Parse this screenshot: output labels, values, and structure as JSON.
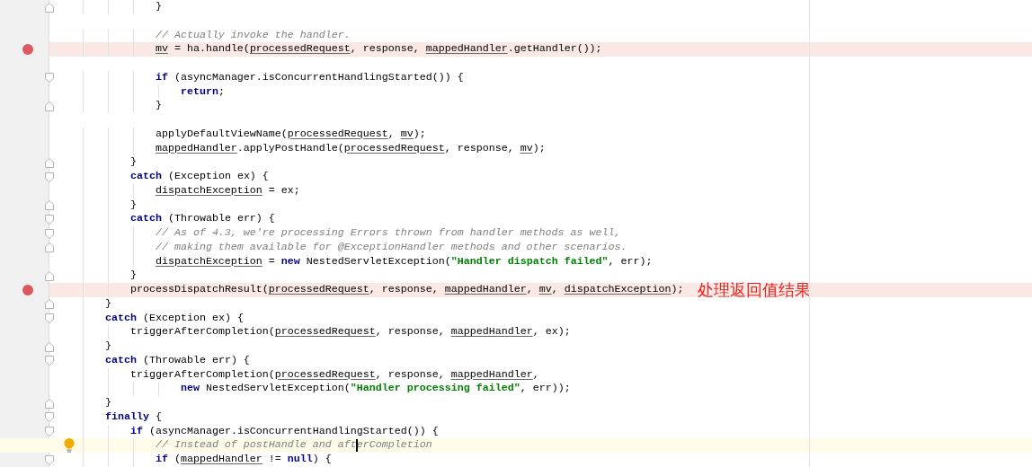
{
  "editor": {
    "lines": [
      {
        "kind": "code",
        "fold_marker": {
          "kind": "end"
        },
        "tokens": [
          {
            "kind": "plain",
            "text": "                }"
          }
        ]
      },
      {
        "kind": "blank"
      },
      {
        "kind": "code",
        "tokens": [
          {
            "kind": "comment",
            "text": "                // Actually invoke the handler."
          }
        ]
      },
      {
        "kind": "code",
        "breakpoint": true,
        "tokens": [
          {
            "kind": "var",
            "text": "                mv"
          },
          {
            "kind": "plain",
            "text": " = ha.handle("
          },
          {
            "kind": "var",
            "text": "processedRequest"
          },
          {
            "kind": "plain",
            "text": ", response, "
          },
          {
            "kind": "var",
            "text": "mappedHandler"
          },
          {
            "kind": "plain",
            "text": ".getHandler());"
          }
        ]
      },
      {
        "kind": "blank"
      },
      {
        "kind": "code",
        "fold_marker": {
          "kind": "start"
        },
        "tokens": [
          {
            "kind": "keyword",
            "text": "                if"
          },
          {
            "kind": "plain",
            "text": " (asyncManager.isConcurrentHandlingStarted()) {"
          }
        ]
      },
      {
        "kind": "code",
        "tokens": [
          {
            "kind": "keyword",
            "text": "                    return"
          },
          {
            "kind": "plain",
            "text": ";"
          }
        ]
      },
      {
        "kind": "code",
        "fold_marker": {
          "kind": "end"
        },
        "tokens": [
          {
            "kind": "plain",
            "text": "                }"
          }
        ]
      },
      {
        "kind": "blank"
      },
      {
        "kind": "code",
        "tokens": [
          {
            "kind": "plain",
            "text": "                applyDefaultViewName("
          },
          {
            "kind": "var",
            "text": "processedRequest"
          },
          {
            "kind": "plain",
            "text": ", "
          },
          {
            "kind": "var",
            "text": "mv"
          },
          {
            "kind": "plain",
            "text": ");"
          }
        ]
      },
      {
        "kind": "code",
        "tokens": [
          {
            "kind": "var",
            "text": "                mappedHandler"
          },
          {
            "kind": "plain",
            "text": ".applyPostHandle("
          },
          {
            "kind": "var",
            "text": "processedRequest"
          },
          {
            "kind": "plain",
            "text": ", response, "
          },
          {
            "kind": "var",
            "text": "mv"
          },
          {
            "kind": "plain",
            "text": ");"
          }
        ]
      },
      {
        "kind": "code",
        "fold_marker": {
          "kind": "end"
        },
        "tokens": [
          {
            "kind": "plain",
            "text": "            }"
          }
        ]
      },
      {
        "kind": "code",
        "fold_marker": {
          "kind": "start"
        },
        "tokens": [
          {
            "kind": "keyword",
            "text": "            catch"
          },
          {
            "kind": "plain",
            "text": " (Exception ex) {"
          }
        ]
      },
      {
        "kind": "code",
        "tokens": [
          {
            "kind": "var",
            "text": "                dispatchException"
          },
          {
            "kind": "plain",
            "text": " = ex;"
          }
        ]
      },
      {
        "kind": "code",
        "fold_marker": {
          "kind": "end"
        },
        "tokens": [
          {
            "kind": "plain",
            "text": "            }"
          }
        ]
      },
      {
        "kind": "code",
        "fold_marker": {
          "kind": "start"
        },
        "tokens": [
          {
            "kind": "keyword",
            "text": "            catch"
          },
          {
            "kind": "plain",
            "text": " (Throwable err) {"
          }
        ]
      },
      {
        "kind": "code",
        "fold_marker": {
          "kind": "start"
        },
        "tokens": [
          {
            "kind": "comment",
            "text": "                // As of 4.3, we're processing Errors thrown from handler methods as well,"
          }
        ]
      },
      {
        "kind": "code",
        "fold_marker": {
          "kind": "end"
        },
        "tokens": [
          {
            "kind": "comment",
            "text": "                // making them available for @ExceptionHandler methods and other scenarios."
          }
        ]
      },
      {
        "kind": "code",
        "tokens": [
          {
            "kind": "var",
            "text": "                dispatchException"
          },
          {
            "kind": "plain",
            "text": " = "
          },
          {
            "kind": "keyword",
            "text": "new"
          },
          {
            "kind": "plain",
            "text": " NestedServletException("
          },
          {
            "kind": "string",
            "text": "\"Handler dispatch failed\""
          },
          {
            "kind": "plain",
            "text": ", err);"
          }
        ]
      },
      {
        "kind": "code",
        "fold_marker": {
          "kind": "end"
        },
        "tokens": [
          {
            "kind": "plain",
            "text": "            }"
          }
        ]
      },
      {
        "kind": "code",
        "breakpoint": true,
        "annotation": "处理返回值结果",
        "tokens": [
          {
            "kind": "plain",
            "text": "            processDispatchResult("
          },
          {
            "kind": "var",
            "text": "processedRequest"
          },
          {
            "kind": "plain",
            "text": ", response, "
          },
          {
            "kind": "var",
            "text": "mappedHandler"
          },
          {
            "kind": "plain",
            "text": ", "
          },
          {
            "kind": "var",
            "text": "mv"
          },
          {
            "kind": "plain",
            "text": ", "
          },
          {
            "kind": "var",
            "text": "dispatchException"
          },
          {
            "kind": "plain",
            "text": ");"
          }
        ]
      },
      {
        "kind": "code",
        "fold_marker": {
          "kind": "end"
        },
        "tokens": [
          {
            "kind": "plain",
            "text": "        }"
          }
        ]
      },
      {
        "kind": "code",
        "fold_marker": {
          "kind": "start"
        },
        "tokens": [
          {
            "kind": "keyword",
            "text": "        catch"
          },
          {
            "kind": "plain",
            "text": " (Exception ex) {"
          }
        ]
      },
      {
        "kind": "code",
        "tokens": [
          {
            "kind": "plain",
            "text": "            triggerAfterCompletion("
          },
          {
            "kind": "var",
            "text": "processedRequest"
          },
          {
            "kind": "plain",
            "text": ", response, "
          },
          {
            "kind": "var",
            "text": "mappedHandler"
          },
          {
            "kind": "plain",
            "text": ", ex);"
          }
        ]
      },
      {
        "kind": "code",
        "fold_marker": {
          "kind": "end"
        },
        "tokens": [
          {
            "kind": "plain",
            "text": "        }"
          }
        ]
      },
      {
        "kind": "code",
        "fold_marker": {
          "kind": "start"
        },
        "tokens": [
          {
            "kind": "keyword",
            "text": "        catch"
          },
          {
            "kind": "plain",
            "text": " (Throwable err) {"
          }
        ]
      },
      {
        "kind": "code",
        "tokens": [
          {
            "kind": "plain",
            "text": "            triggerAfterCompletion("
          },
          {
            "kind": "var",
            "text": "processedRequest"
          },
          {
            "kind": "plain",
            "text": ", response, "
          },
          {
            "kind": "var",
            "text": "mappedHandler"
          },
          {
            "kind": "plain",
            "text": ","
          }
        ]
      },
      {
        "kind": "code",
        "tokens": [
          {
            "kind": "keyword",
            "text": "                    new"
          },
          {
            "kind": "plain",
            "text": " NestedServletException("
          },
          {
            "kind": "string",
            "text": "\"Handler processing failed\""
          },
          {
            "kind": "plain",
            "text": ", err));"
          }
        ]
      },
      {
        "kind": "code",
        "fold_marker": {
          "kind": "end"
        },
        "tokens": [
          {
            "kind": "plain",
            "text": "        }"
          }
        ]
      },
      {
        "kind": "code",
        "fold_marker": {
          "kind": "start"
        },
        "tokens": [
          {
            "kind": "keyword",
            "text": "        finally"
          },
          {
            "kind": "plain",
            "text": " {"
          }
        ]
      },
      {
        "kind": "code",
        "fold_marker": {
          "kind": "start"
        },
        "tokens": [
          {
            "kind": "keyword",
            "text": "            if"
          },
          {
            "kind": "plain",
            "text": " (asyncManager.isConcurrentHandlingStarted()) {"
          }
        ]
      },
      {
        "kind": "code",
        "current": true,
        "intention_bulb": true,
        "tokens": [
          {
            "kind": "comment",
            "text": "                // Instead of postHandle and aft"
          },
          {
            "kind": "comment",
            "caret": true,
            "text": "erCompletion"
          }
        ]
      },
      {
        "kind": "code",
        "fold_marker": {
          "kind": "start"
        },
        "tokens": [
          {
            "kind": "keyword",
            "text": "                if"
          },
          {
            "kind": "plain",
            "text": " ("
          },
          {
            "kind": "var",
            "text": "mappedHandler"
          },
          {
            "kind": "plain",
            "text": " != "
          },
          {
            "kind": "keyword",
            "text": "null"
          },
          {
            "kind": "plain",
            "text": ") {"
          }
        ]
      }
    ]
  }
}
